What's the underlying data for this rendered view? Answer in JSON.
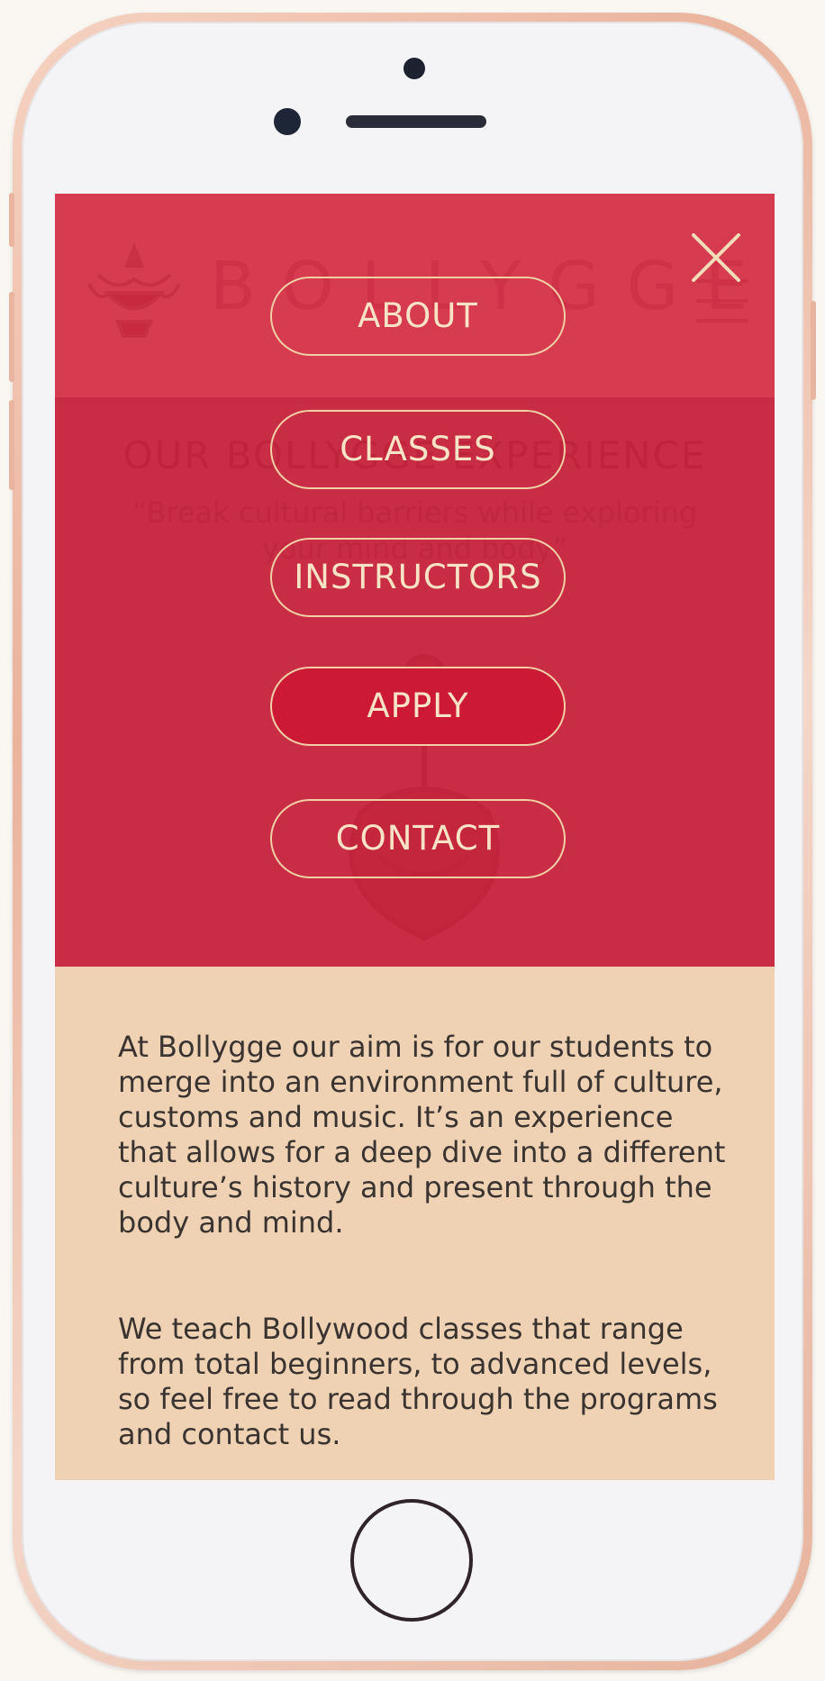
{
  "site": {
    "brand": "BOLLYGGE",
    "hero_title": "OUR BOLLYGGE EXPERIENCE",
    "hero_quote": "“Break cultural barriers while exploring your mind and body”"
  },
  "menu": {
    "items": [
      {
        "label": "ABOUT",
        "active": false
      },
      {
        "label": "CLASSES",
        "active": false
      },
      {
        "label": "INSTRUCTORS",
        "active": false
      },
      {
        "label": "APPLY",
        "active": true
      },
      {
        "label": "CONTACT",
        "active": false
      }
    ]
  },
  "content": {
    "paragraph_1": "At Bollygge our aim is for our students to merge into an environment full of culture, customs and music. It’s an experience that allows for a deep dive into a different culture’s history and present through the body and mind.",
    "paragraph_2": "We teach Bollywood classes that range from total beginners, to advanced levels, so feel free to read through the programs and contact us."
  },
  "colors": {
    "header_bg": "#d63b4f",
    "hero_bg": "#c92d45",
    "content_bg": "#efd2b4",
    "menu_border": "#f0cfa6",
    "active_bg": "#cc1a36"
  },
  "icons": {
    "close": "close-icon",
    "menu": "hamburger-icon",
    "logo": "genie-lamp-logo-icon"
  }
}
